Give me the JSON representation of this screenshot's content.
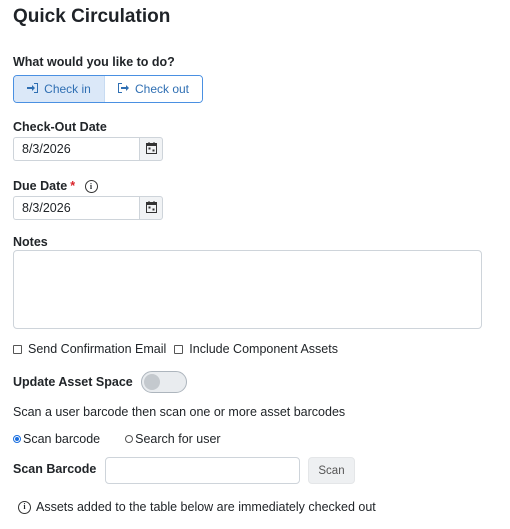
{
  "page_title": "Quick Circulation",
  "action_prompt": "What would you like to do?",
  "mode_toggle": {
    "check_in_label": "Check in",
    "check_out_label": "Check out",
    "selected": "Check out"
  },
  "checkout_date": {
    "label": "Check-Out Date",
    "value": "8/3/2026"
  },
  "due_date": {
    "label": "Due Date",
    "required_mark": "*",
    "info_glyph": "i",
    "value": "8/3/2026"
  },
  "notes": {
    "label": "Notes",
    "value": ""
  },
  "options": {
    "send_email_label": "Send Confirmation Email",
    "send_email_checked": false,
    "include_components_label": "Include Component Assets",
    "include_components_checked": false
  },
  "update_asset_space": {
    "label": "Update Asset Space",
    "enabled": false
  },
  "instruction": "Scan a user barcode then scan one or more asset barcodes",
  "scan_mode": {
    "scan_barcode_label": "Scan barcode",
    "search_user_label": "Search for user",
    "selected": "Scan barcode"
  },
  "scan_barcode": {
    "label": "Scan Barcode",
    "value": "",
    "button_label": "Scan"
  },
  "footer_note": {
    "info_glyph": "i",
    "text": "Assets added to the table below are immediately checked out"
  },
  "colors": {
    "accent": "#4a90e2",
    "required": "#d9232a",
    "toggle_bg": "#e9ecef"
  },
  "icons": [
    "sign-in-icon",
    "sign-out-icon",
    "calendar-icon",
    "info-icon"
  ]
}
